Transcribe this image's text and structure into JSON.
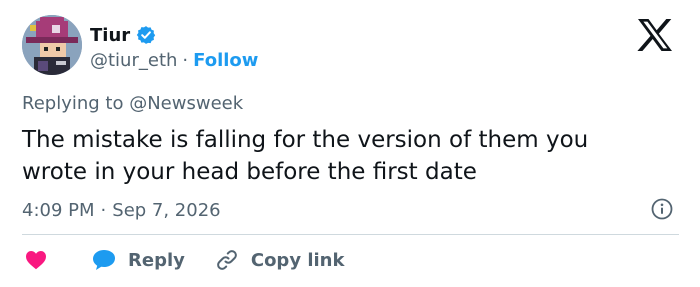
{
  "author": {
    "display_name": "Tiur",
    "handle": "@tiur_eth",
    "follow_label": "Follow",
    "separator": "·"
  },
  "reply_context": {
    "prefix": "Replying to",
    "mention": "@Newsweek"
  },
  "tweet": {
    "lines": [
      "The mistake is falling for the version of them you",
      "wrote in your head before the first date"
    ]
  },
  "meta": {
    "time": "4:09 PM",
    "separator": "·",
    "date": "Sep 7, 2026"
  },
  "actions": {
    "reply_label": "Reply",
    "copy_link_label": "Copy link"
  },
  "icons": {
    "verified": "verified-badge-icon",
    "brand": "x-logo-icon",
    "info": "info-icon",
    "like": "heart-icon",
    "reply": "reply-bubble-icon",
    "copy": "link-icon"
  },
  "colors": {
    "text": "#0f1419",
    "secondary": "#536471",
    "accent": "#1d9bf0",
    "like": "#f91880",
    "divider": "#cfd9de"
  }
}
